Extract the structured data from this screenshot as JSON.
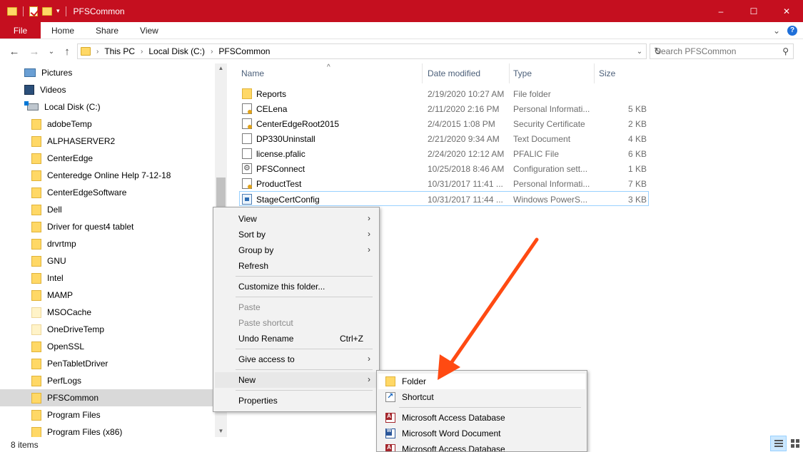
{
  "window": {
    "title": "PFSCommon",
    "title_bar_color": "#c50f1f",
    "controls": {
      "minimize": "–",
      "maximize": "☐",
      "close": "✕"
    }
  },
  "ribbon": {
    "file_tab": "File",
    "tabs": [
      "Home",
      "Share",
      "View"
    ],
    "expand_icon": "⌄",
    "help_icon": "?"
  },
  "address": {
    "back": "←",
    "forward": "→",
    "recent": "⌄",
    "up": "↑",
    "crumbs": [
      "This PC",
      "Local Disk (C:)",
      "PFSCommon"
    ],
    "search_placeholder": "Search PFSCommon"
  },
  "nav": {
    "items": [
      {
        "label": "Pictures",
        "icon": "pictures-icon"
      },
      {
        "label": "Videos",
        "icon": "videos-icon"
      },
      {
        "label": "Local Disk (C:)",
        "icon": "disk-icon"
      },
      {
        "label": "adobeTemp",
        "icon": "folder-icon"
      },
      {
        "label": "ALPHASERVER2",
        "icon": "folder-icon"
      },
      {
        "label": "CenterEdge",
        "icon": "folder-icon"
      },
      {
        "label": "Centeredge Online Help 7-12-18",
        "icon": "folder-icon"
      },
      {
        "label": "CenterEdgeSoftware",
        "icon": "folder-icon"
      },
      {
        "label": "Dell",
        "icon": "folder-icon"
      },
      {
        "label": "Driver for quest4 tablet",
        "icon": "folder-icon"
      },
      {
        "label": "drvrtmp",
        "icon": "folder-icon"
      },
      {
        "label": "GNU",
        "icon": "folder-icon"
      },
      {
        "label": "Intel",
        "icon": "folder-icon"
      },
      {
        "label": "MAMP",
        "icon": "folder-icon"
      },
      {
        "label": "MSOCache",
        "icon": "pale-folder-icon"
      },
      {
        "label": "OneDriveTemp",
        "icon": "pale-folder-icon"
      },
      {
        "label": "OpenSSL",
        "icon": "folder-icon"
      },
      {
        "label": "PenTabletDriver",
        "icon": "folder-icon"
      },
      {
        "label": "PerfLogs",
        "icon": "folder-icon"
      },
      {
        "label": "PFSCommon",
        "icon": "folder-icon",
        "selected": true
      },
      {
        "label": "Program Files",
        "icon": "folder-icon"
      },
      {
        "label": "Program Files (x86)",
        "icon": "folder-icon"
      }
    ]
  },
  "list": {
    "columns": {
      "name": "Name",
      "date": "Date modified",
      "type": "Type",
      "size": "Size"
    },
    "sort_indicator": "^",
    "files": [
      {
        "name": "Reports",
        "date": "2/19/2020 10:27 AM",
        "type": "File folder",
        "size": "",
        "icon": "folder"
      },
      {
        "name": "CELena",
        "date": "2/11/2020 2:16 PM",
        "type": "Personal Informati...",
        "size": "5 KB",
        "icon": "cert"
      },
      {
        "name": "CenterEdgeRoot2015",
        "date": "2/4/2015 1:08 PM",
        "type": "Security Certificate",
        "size": "2 KB",
        "icon": "cert"
      },
      {
        "name": "DP330Uninstall",
        "date": "2/21/2020 9:34 AM",
        "type": "Text Document",
        "size": "4 KB",
        "icon": "doc"
      },
      {
        "name": "license.pfalic",
        "date": "2/24/2020 12:12 AM",
        "type": "PFALIC File",
        "size": "6 KB",
        "icon": "doc"
      },
      {
        "name": "PFSConnect",
        "date": "10/25/2018 8:46 AM",
        "type": "Configuration sett...",
        "size": "1 KB",
        "icon": "conf"
      },
      {
        "name": "ProductTest",
        "date": "10/31/2017 11:41 ...",
        "type": "Personal Informati...",
        "size": "7 KB",
        "icon": "cert"
      },
      {
        "name": "StageCertConfig",
        "date": "10/31/2017 11:44 ...",
        "type": "Windows PowerS...",
        "size": "3 KB",
        "icon": "ps",
        "selected": true
      }
    ]
  },
  "status": {
    "item_count": "8 items"
  },
  "context_menu": {
    "items": [
      {
        "label": "View",
        "submenu": true
      },
      {
        "label": "Sort by",
        "submenu": true
      },
      {
        "label": "Group by",
        "submenu": true
      },
      {
        "label": "Refresh"
      },
      {
        "label": "Customize this folder..."
      },
      {
        "label": "Paste",
        "disabled": true
      },
      {
        "label": "Paste shortcut",
        "disabled": true
      },
      {
        "label": "Undo Rename",
        "shortcut": "Ctrl+Z"
      },
      {
        "label": "Give access to",
        "submenu": true
      },
      {
        "label": "New",
        "submenu": true,
        "active": true
      },
      {
        "label": "Properties"
      }
    ],
    "submenu_arrow": "›"
  },
  "new_submenu": {
    "items": [
      {
        "label": "Folder",
        "icon": "folder"
      },
      {
        "label": "Shortcut",
        "icon": "shortcut"
      },
      {
        "label": "Microsoft Access Database",
        "icon": "access"
      },
      {
        "label": "Microsoft Word Document",
        "icon": "word"
      },
      {
        "label": "Microsoft Access Database",
        "icon": "access"
      }
    ]
  },
  "annotation": {
    "arrow_color": "#ff4a12"
  }
}
